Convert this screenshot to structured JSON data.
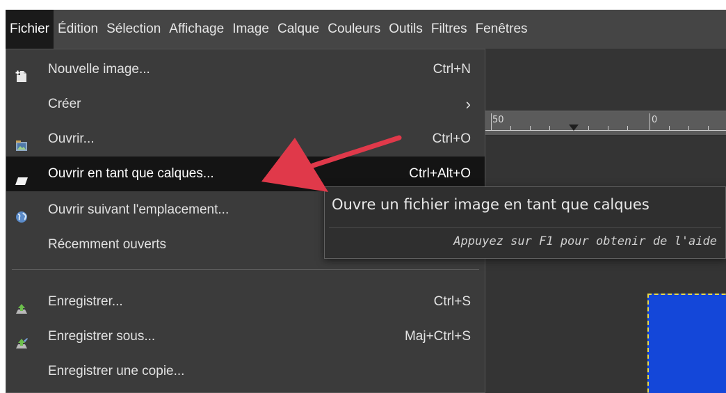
{
  "menubar": {
    "items": [
      {
        "label": "Fichier",
        "active": true
      },
      {
        "label": "Édition"
      },
      {
        "label": "Sélection"
      },
      {
        "label": "Affichage"
      },
      {
        "label": "Image"
      },
      {
        "label": "Calque"
      },
      {
        "label": "Couleurs"
      },
      {
        "label": "Outils"
      },
      {
        "label": "Filtres"
      },
      {
        "label": "Fenêtres"
      }
    ]
  },
  "file_menu": {
    "items": [
      {
        "label": "Nouvelle image...",
        "shortcut": "Ctrl+N",
        "icon": "new-image-icon"
      },
      {
        "label": "Créer",
        "submenu": true
      },
      {
        "label": "Ouvrir...",
        "shortcut": "Ctrl+O",
        "icon": "open-icon"
      },
      {
        "label": "Ouvrir en tant que calques...",
        "shortcut": "Ctrl+Alt+O",
        "icon": "open-as-layers-icon",
        "highlighted": true
      },
      {
        "label": "Ouvrir suivant l'emplacement...",
        "icon": "open-location-icon"
      },
      {
        "label": "Récemment ouverts"
      },
      {
        "label": "Enregistrer...",
        "shortcut": "Ctrl+S",
        "icon": "save-icon"
      },
      {
        "label": "Enregistrer sous...",
        "shortcut": "Maj+Ctrl+S",
        "icon": "save-as-icon"
      },
      {
        "label": "Enregistrer une copie..."
      }
    ],
    "submenu_glyph": "›"
  },
  "tooltip": {
    "title": "Ouvre un fichier image en tant que calques",
    "hint": "Appuyez sur F1 pour obtenir de l'aide"
  },
  "ruler": {
    "labels": [
      "50",
      "0"
    ]
  },
  "colors": {
    "annotation_arrow": "#e0394a",
    "canvas_image": "#1447d9",
    "selection_border": "#e8d84a",
    "menu_highlight": "#141414"
  }
}
